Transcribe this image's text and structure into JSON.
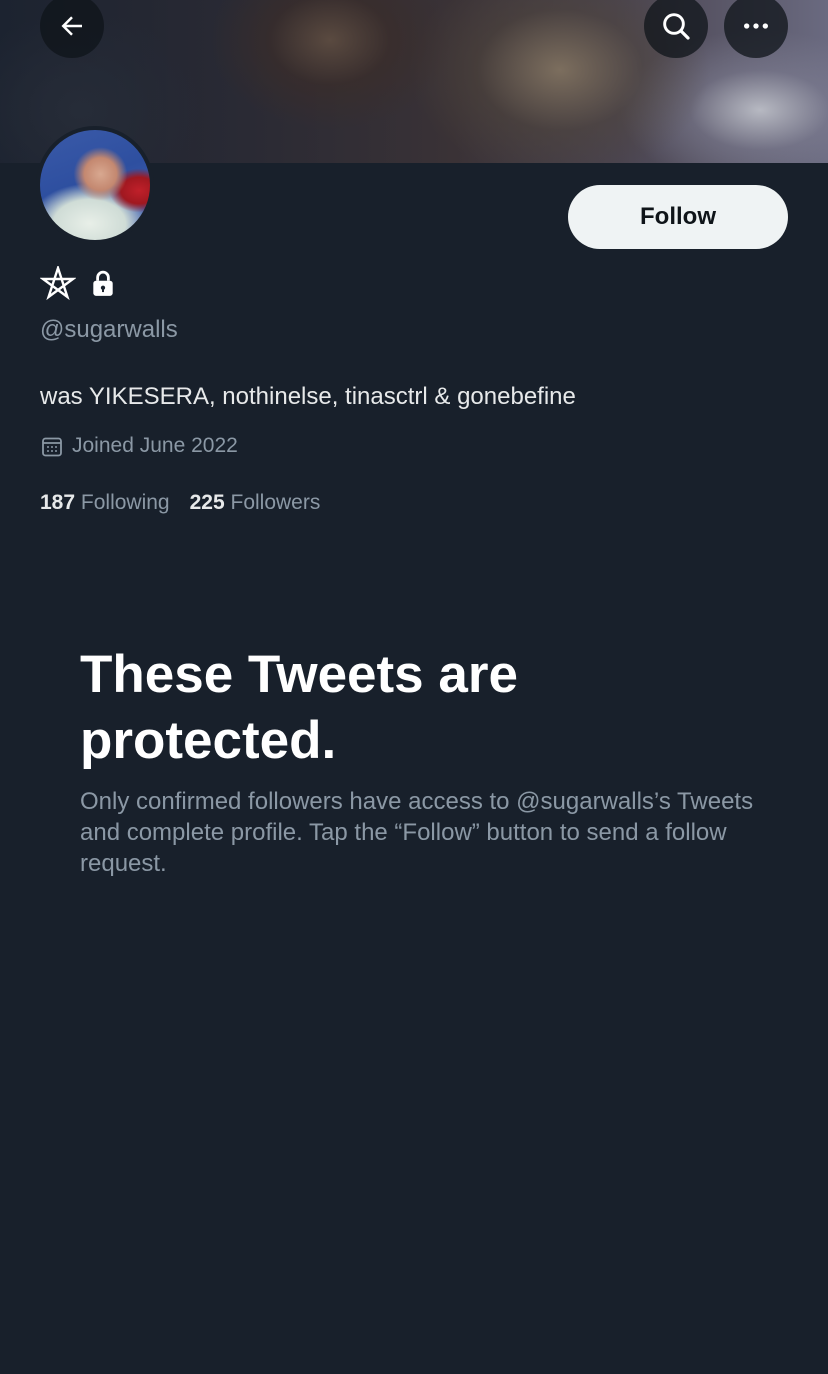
{
  "header": {
    "back_icon": "arrow-left-icon",
    "search_icon": "search-icon",
    "more_icon": "more-horizontal-icon"
  },
  "profile": {
    "name_icons": [
      "pentagram-icon",
      "lock-icon"
    ],
    "handle": "@sugarwalls",
    "bio": "was YIKESERA, nothinelse, tinasctrl & gonebefine",
    "joined": "Joined June 2022",
    "following_count": "187",
    "following_label": "Following",
    "followers_count": "225",
    "followers_label": "Followers"
  },
  "follow_button": {
    "label": "Follow"
  },
  "protected": {
    "title": "These Tweets are protected.",
    "text": "Only confirmed followers have access to @sugarwalls’s Tweets and complete profile. Tap the “Follow” button to send a follow request."
  },
  "colors": {
    "background": "#18202b",
    "primary_text": "#e7e9ea",
    "secondary_text": "#8b98a5",
    "button_bg": "#eff3f4"
  }
}
